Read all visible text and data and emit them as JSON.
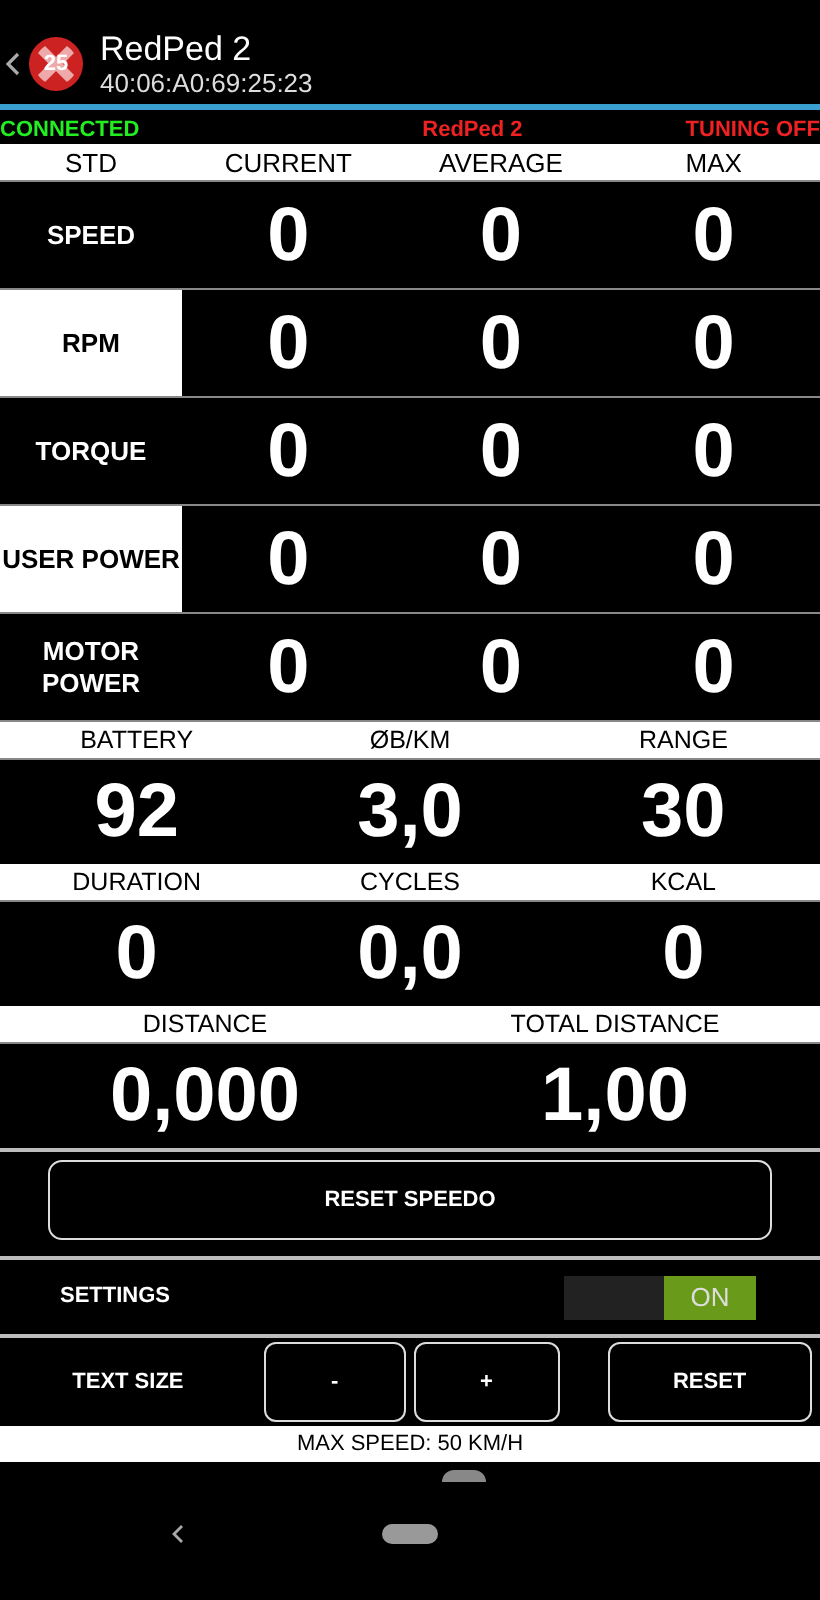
{
  "header": {
    "title": "RedPed 2",
    "subtitle": "40:06:A0:69:25:23",
    "logo_number": "25"
  },
  "status_strip": {
    "left": "CONNECTED",
    "center": "RedPed 2",
    "right": "TUNING OFF"
  },
  "metrics_table": {
    "columns": [
      "STD",
      "CURRENT",
      "AVERAGE",
      "MAX"
    ],
    "rows": [
      {
        "label": "SPEED",
        "highlighted": false,
        "values": [
          "0",
          "0",
          "0"
        ]
      },
      {
        "label": "RPM",
        "highlighted": true,
        "values": [
          "0",
          "0",
          "0"
        ]
      },
      {
        "label": "TORQUE",
        "highlighted": false,
        "values": [
          "0",
          "0",
          "0"
        ]
      },
      {
        "label": "USER POWER",
        "highlighted": true,
        "values": [
          "0",
          "0",
          "0"
        ]
      },
      {
        "label": "MOTOR POWER",
        "highlighted": false,
        "values": [
          "0",
          "0",
          "0"
        ]
      }
    ]
  },
  "stats": [
    [
      {
        "label": "BATTERY",
        "value": "92"
      },
      {
        "label": "ØB/KM",
        "value": "3,0"
      },
      {
        "label": "RANGE",
        "value": "30"
      }
    ],
    [
      {
        "label": "DURATION",
        "value": "0"
      },
      {
        "label": "CYCLES",
        "value": "0,0"
      },
      {
        "label": "KCAL",
        "value": "0"
      }
    ],
    [
      {
        "label": "DISTANCE",
        "value": "0,000"
      },
      {
        "label": "TOTAL DISTANCE",
        "value": "1,00"
      }
    ]
  ],
  "reset_speedo_button": "RESET SPEEDO",
  "settings": {
    "label": "SETTINGS",
    "toggle_label": "ON",
    "on": true
  },
  "text_size": {
    "label": "TEXT SIZE",
    "buttons": [
      "-",
      "+",
      "RESET"
    ]
  },
  "footer": "MAX SPEED: 50 KM/H"
}
